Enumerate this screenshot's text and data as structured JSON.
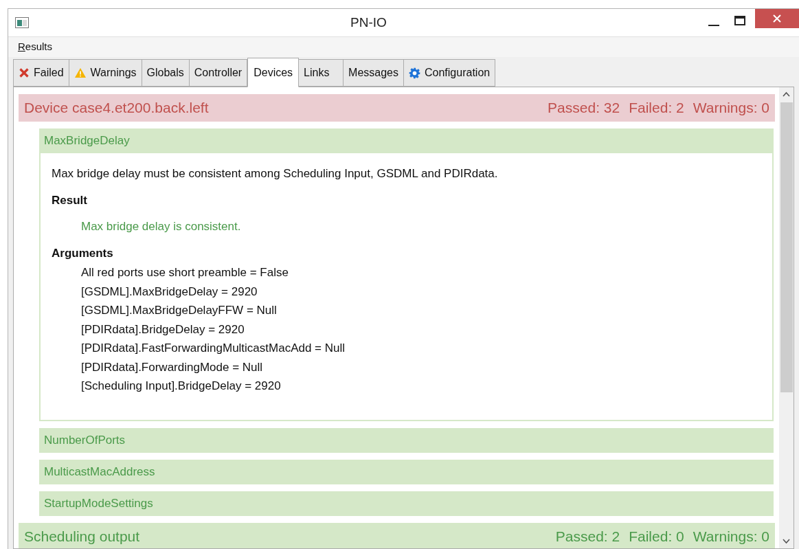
{
  "window": {
    "title": "PN-IO"
  },
  "menu": [
    "Results"
  ],
  "tabs": [
    {
      "label": "Failed",
      "kind": "error",
      "selected": false
    },
    {
      "label": "Warnings",
      "kind": "warning",
      "selected": false
    },
    {
      "label": "Globals",
      "selected": false
    },
    {
      "label": "Controller",
      "selected": false
    },
    {
      "label": "Devices",
      "selected": true
    },
    {
      "label": "Links",
      "selected": false
    },
    {
      "label": "Messages",
      "selected": false
    },
    {
      "label": "Configuration",
      "kind": "settings",
      "selected": false
    }
  ],
  "groups": [
    {
      "title": "Device case4.et200.back.left",
      "failed": true,
      "counts": [
        "Passed: 32",
        "Failed: 2",
        "Warnings: 0"
      ],
      "checks": [
        {
          "title": "MaxBridgeDelay",
          "failed": false,
          "expanded": true,
          "description": "Max bridge delay must be consistent among Scheduling Input, GSDML and PDIRdata.",
          "result_heading": "Result",
          "result": "Max bridge delay is consistent.",
          "arguments_heading": "Arguments",
          "arguments": [
            "All red ports use short preamble = False",
            "[GSDML].MaxBridgeDelay = 2920",
            "[GSDML].MaxBridgeDelayFFW = Null",
            "[PDIRdata].BridgeDelay = 2920",
            "[PDIRdata].FastForwardingMulticastMacAdd = Null",
            "[PDIRdata].ForwardingMode = Null",
            "[Scheduling Input].BridgeDelay = 2920"
          ]
        },
        {
          "title": "NumberOfPorts",
          "failed": false,
          "expanded": false
        },
        {
          "title": "MulticastMacAddress",
          "failed": false,
          "expanded": false
        },
        {
          "title": "StartupModeSettings",
          "failed": false,
          "expanded": false
        }
      ]
    },
    {
      "title": "Scheduling output",
      "failed": false,
      "counts": [
        "Passed: 2",
        "Failed: 0",
        "Warnings: 0"
      ]
    }
  ]
}
